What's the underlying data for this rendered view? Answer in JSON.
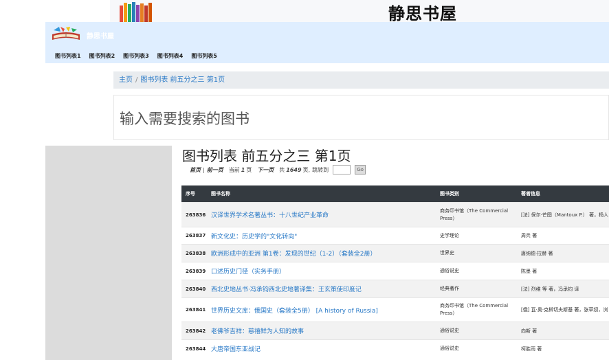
{
  "site": {
    "title": "静思书屋",
    "brand": "静思书屋"
  },
  "nav": {
    "items": [
      "图书列表1",
      "图书列表2",
      "图书列表3",
      "图书列表4",
      "图书列表5"
    ]
  },
  "breadcrumb": {
    "home": "主页",
    "separator": "/",
    "current": "图书列表 前五分之三 第1页"
  },
  "search": {
    "placeholder": "输入需要搜索的图书"
  },
  "page": {
    "title": "图书列表 前五分之三 第1页"
  },
  "pager": {
    "first": "首页",
    "divider": "|",
    "prev": "前一页",
    "current_prefix": "当前",
    "current_page": "1",
    "page_unit": "页",
    "next": "下一页",
    "total_prefix": "共",
    "total_pages": "1649",
    "total_suffix": "页,",
    "jump_label": "跳转到",
    "go_label": "Go"
  },
  "table": {
    "headers": [
      "序号",
      "图书名称",
      "图书类别",
      "著者信息"
    ],
    "rows": [
      {
        "id": "263836",
        "name": "汉译世界学术名著丛书：十八世纪产业革命",
        "category": "商务印书馆（The Commercial Press）",
        "author": "[法] 保尔·芒图（Mantoux P.） 著，杨人"
      },
      {
        "id": "263837",
        "name": "新文化史：历史学的\"文化转向\"",
        "category": "史学理论",
        "author": "周兵 著"
      },
      {
        "id": "263838",
        "name": "欧洲形成中的亚洲 第1卷：发现的世纪（1-2）（套装全2册）",
        "category": "世界史",
        "author": "唐纳德·拉赫 著"
      },
      {
        "id": "263839",
        "name": "口述历史门径（实务手册）",
        "category": "通俗说史",
        "author": "陈墨 著"
      },
      {
        "id": "263840",
        "name": "西北史地丛书·冯承钧西北史地著译集：王玄策使印度记",
        "category": "经典著作",
        "author": "[法] 烈维 等 著，冯承钧 译"
      },
      {
        "id": "263841",
        "name": "世界历史文库：俄国史（套装全5册） [A history of Russia]",
        "category": "商务印书馆（The Commercial Press）",
        "author": "[俄] 瓦·奥·克柳切夫斯基 著，张草纫，浏"
      },
      {
        "id": "263842",
        "name": "老佛爷吉祥：慈禧鲜为人知的故事",
        "category": "通俗说史",
        "author": "向斯 著"
      },
      {
        "id": "263844",
        "name": "大唐帝国东亚战记",
        "category": "通俗说史",
        "author": "柯胜雨 著"
      }
    ]
  },
  "colors": {
    "navbar": "#dfeeff",
    "table_header": "#343a40",
    "link": "#2a7ac7",
    "sidebar": "#dcdcdc"
  },
  "icons": {
    "banner": "books-icon",
    "brand": "open-book-logo-icon"
  }
}
